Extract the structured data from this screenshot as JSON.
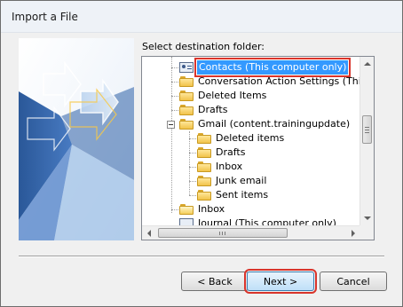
{
  "window": {
    "title": "Import a File"
  },
  "main": {
    "destination_label": "Select destination folder:"
  },
  "tree": {
    "items": [
      {
        "label": "Contacts (This computer only)",
        "icon": "contacts-icon",
        "selected": true
      },
      {
        "label": "Conversation Action Settings (This c",
        "icon": "folder-icon"
      },
      {
        "label": "Deleted Items",
        "icon": "folder-icon"
      },
      {
        "label": "Drafts",
        "icon": "folder-icon"
      },
      {
        "label": "Gmail (content.trainingupdate)",
        "icon": "folder-icon",
        "expanded": true
      },
      {
        "label": "Deleted items",
        "icon": "folder-icon"
      },
      {
        "label": "Drafts",
        "icon": "folder-icon"
      },
      {
        "label": "Inbox",
        "icon": "folder-icon"
      },
      {
        "label": "Junk email",
        "icon": "folder-icon"
      },
      {
        "label": "Sent items",
        "icon": "folder-icon"
      },
      {
        "label": "Inbox",
        "icon": "inbox-folder-icon"
      },
      {
        "label": "Journal (This computer only)",
        "icon": "journal-icon"
      }
    ]
  },
  "buttons": {
    "back": "< Back",
    "next": "Next >",
    "cancel": "Cancel"
  },
  "colors": {
    "selection": "#3399ff",
    "highlight_outline": "#d9342b",
    "banner_blue": "#2b5797"
  }
}
